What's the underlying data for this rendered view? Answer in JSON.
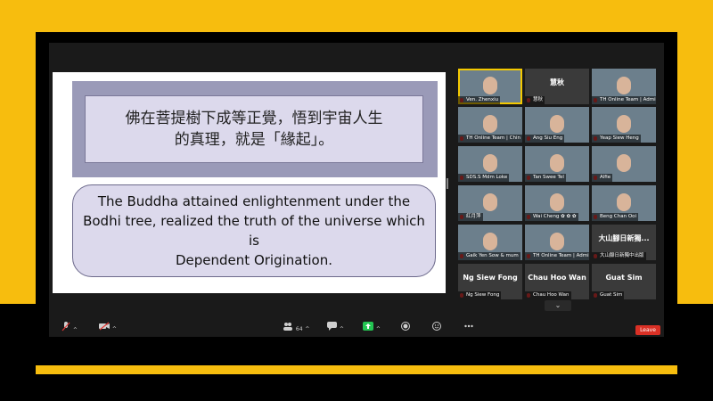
{
  "slide": {
    "chinese_line1": "佛在菩提樹下成等正覺，悟到宇宙人生",
    "chinese_line2": "的真理，就是「緣起」。",
    "english_line1": "The Buddha attained enlightenment under the",
    "english_line2": "Bodhi tree, realized the truth of the universe which",
    "english_line3": "is",
    "english_line4": "Dependent Origination."
  },
  "participants": [
    {
      "name": "Ven. Zhenxiu",
      "big": "",
      "kind": "video",
      "active": true
    },
    {
      "name": "慧秋",
      "big": "慧秋",
      "kind": "name"
    },
    {
      "name": "TH Online Team | Admi",
      "big": "",
      "kind": "video"
    },
    {
      "name": "TH Online Team | Chin",
      "big": "",
      "kind": "video"
    },
    {
      "name": "Ang Siu Eng",
      "big": "",
      "kind": "video"
    },
    {
      "name": "Yeap Siew Heng",
      "big": "",
      "kind": "video"
    },
    {
      "name": "SDS.S Mdm Loke",
      "big": "",
      "kind": "video"
    },
    {
      "name": "Tan Swee Tel",
      "big": "",
      "kind": "video"
    },
    {
      "name": "Alfie",
      "big": "",
      "kind": "video"
    },
    {
      "name": "红月萍",
      "big": "",
      "kind": "video"
    },
    {
      "name": "Wai Cheng ✿ ✿ ✿",
      "big": "",
      "kind": "video"
    },
    {
      "name": "Beng Chan Ooi",
      "big": "",
      "kind": "video"
    },
    {
      "name": "Gaik Yen Sow & mum",
      "big": "",
      "kind": "video"
    },
    {
      "name": "TH Online Team | Admi",
      "big": "",
      "kind": "video"
    },
    {
      "name": "大山腳日新獨中出版",
      "big": "大山腳日新獨...",
      "kind": "name"
    },
    {
      "name": "Ng Siew Fong",
      "big": "Ng Siew Fong",
      "kind": "name"
    },
    {
      "name": "Chau Hoo Wan",
      "big": "Chau Hoo Wan",
      "kind": "name"
    },
    {
      "name": "Guat Sim",
      "big": "Guat Sim",
      "kind": "name"
    }
  ],
  "toolbar": {
    "participants_count": "64",
    "leave_label": "Leave"
  },
  "icons": {
    "mute": "microphone-icon",
    "video": "camera-icon",
    "participants": "people-icon",
    "chat": "chat-bubble-icon",
    "share": "share-screen-icon",
    "record": "record-icon",
    "reactions": "reaction-icon",
    "more": "more-icon",
    "page_down": "chevron-down-icon"
  },
  "colors": {
    "accent_band": "#f7bd0e",
    "active_speaker": "#f4c900",
    "leave": "#d93025"
  }
}
